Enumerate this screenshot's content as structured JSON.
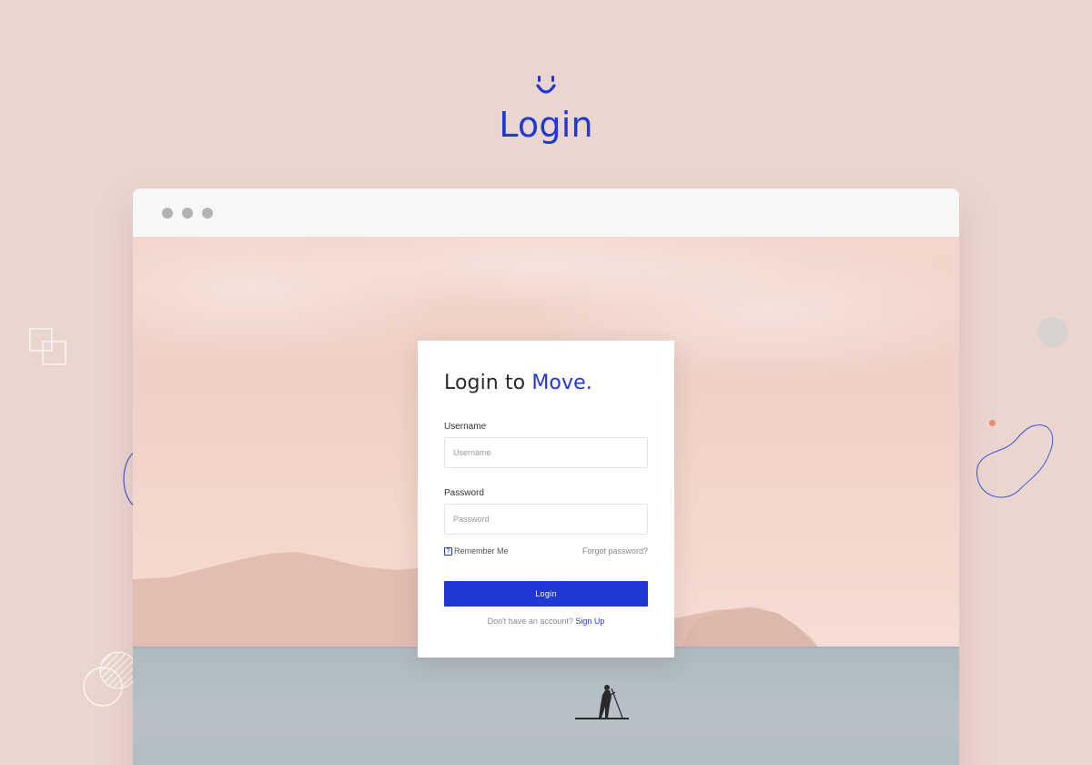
{
  "page": {
    "title": "Login",
    "brand_color": "#1f38d6",
    "background_color": "#ebd6cf"
  },
  "icons": {
    "brand": "smile-logo-icon",
    "checkbox": "checkbox-icon"
  },
  "login_card": {
    "heading_prefix": "Login to",
    "heading_brand": "Move.",
    "username_label": "Username",
    "username_placeholder": "Username",
    "username_value": "",
    "password_label": "Password",
    "password_placeholder": "Password",
    "password_value": "",
    "remember_label": "Remember Me",
    "remember_checked": false,
    "forgot_label": "Forgot password?",
    "login_button_label": "Login",
    "signup_prompt": "Don't have an account?",
    "signup_link_label": "Sign Up"
  }
}
